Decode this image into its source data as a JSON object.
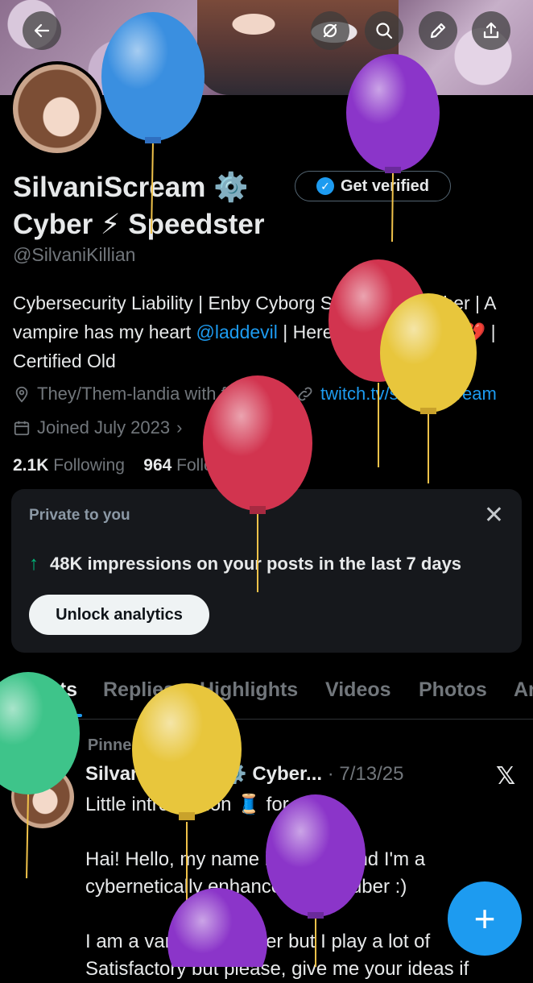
{
  "header": {
    "back_label": "Back",
    "actions": [
      "mute-icon",
      "search-icon",
      "edit-icon",
      "share-icon"
    ]
  },
  "profile": {
    "name_line1": "SilvaniScream ⚙️",
    "name_line2": "Cyber ⚡ Speedster",
    "handle": "@SilvaniKillian",
    "verify_label": "Get verified",
    "bio_part1": "Cybersecurity Liability | Enby Cyborg Speedster VTuber | A vampire has my heart ",
    "bio_mention": "@laddevil",
    "bio_part2": " | Heretical boy-failure 💔 | Certified Old",
    "location": "They/Them-landia with fries",
    "website": "twitch.tv/silvaniscream",
    "joined": "Joined July 2023",
    "following_count": "2.1K",
    "following_label": "Following",
    "followers_count": "964",
    "followers_label": "Followers"
  },
  "private_card": {
    "title": "Private to you",
    "impressions": "48K impressions on your posts in the last 7 days",
    "unlock_label": "Unlock analytics"
  },
  "tabs": [
    "Posts",
    "Replies",
    "Highlights",
    "Videos",
    "Photos",
    "Ar"
  ],
  "post": {
    "pinned_label": "Pinned",
    "author": "SilvaniScream ⚙️ Cyber...",
    "date": "· 7/13/25",
    "body": "Little introduction 🧵 for y'all\n\nHai! Hello, my name is Silvani and I'm a cybernetically enhanced PNGTuber :)\n\nI am a variety streamer but I play a lot of Satisfactory but please, give me your ideas if"
  },
  "fab_label": "+",
  "colors": {
    "accent": "#1d9bf0",
    "balloon_blue": "#3a8fe0",
    "balloon_purple": "#8b35c9",
    "balloon_red": "#d2344f",
    "balloon_yellow": "#e8c63c",
    "balloon_green": "#3ec48a"
  }
}
